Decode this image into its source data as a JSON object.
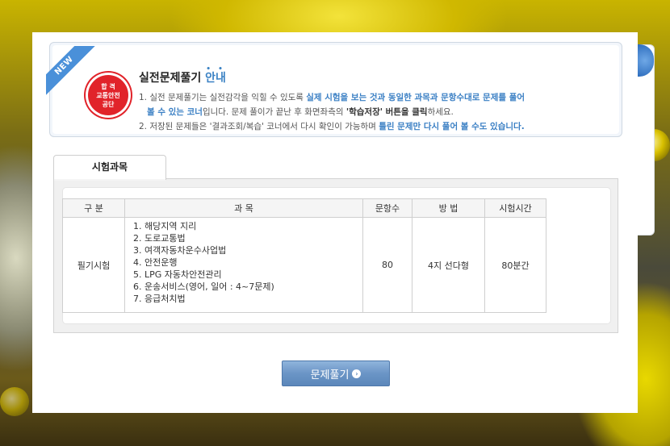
{
  "guide": {
    "badge": "NEW",
    "seal_lines": [
      "합 격",
      "교통안전",
      "공단"
    ],
    "title_main": "실전문제풀기",
    "title_accent": "안내",
    "line1_a": "1. 실전 문제풀기는 실전감각을 익힐 수 있도록 ",
    "line1_b": "실제 시험을 보는 것과 동일한 과목과 문항수대로 문제를 풀어",
    "line2_a": "볼 수 있는 코너",
    "line2_b": "입니다. 문제 풀이가 끝난 후 화면좌측의 ",
    "line2_c": "'학습저장' 버튼을 클릭",
    "line2_d": "하세요.",
    "line3_a": "2. 저장된 문제들은 '결과조회/복습' 코너에서 다시 확인이 가능하며 ",
    "line3_b": "틀린 문제만 다시 풀어 볼 수도 있습니다."
  },
  "tab": {
    "label": "시험과목"
  },
  "table": {
    "headers": [
      "구 분",
      "과 목",
      "문항수",
      "방 법",
      "시험시간"
    ],
    "row": {
      "category": "필기시험",
      "subjects": [
        "1. 해당지역 지리",
        "2. 도로교통법",
        "3. 여객자동차운수사업법",
        "4. 안전운행",
        "5. LPG 자동차안전관리",
        "6. 운송서비스(영어, 일어 : 4~7문제)",
        "7. 응급처치법"
      ],
      "count": "80",
      "method": "4지 선다형",
      "time": "80분간"
    }
  },
  "button": {
    "label": "문제풀기"
  }
}
